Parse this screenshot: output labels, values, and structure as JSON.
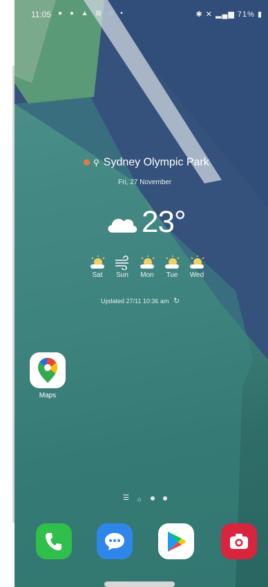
{
  "status_bar": {
    "time": "11:05",
    "left_icons": "● ● ▲ ⊠ ◌ •",
    "battery": "71%"
  },
  "weather": {
    "location": "Sydney Olympic Park",
    "date": "Fri, 27 November",
    "temperature": "23°",
    "forecast": [
      {
        "day": "Sat",
        "icon": "sun-cloud-icon"
      },
      {
        "day": "Sun",
        "icon": "wind-icon"
      },
      {
        "day": "Mon",
        "icon": "sun-cloud-icon"
      },
      {
        "day": "Tue",
        "icon": "sun-cloud-icon"
      },
      {
        "day": "Wed",
        "icon": "sun-cloud-icon"
      }
    ],
    "updated": "Updated 27/11 10:36 am"
  },
  "apps": {
    "maps": {
      "label": "Maps",
      "icon": "google-maps-icon"
    }
  },
  "page_indicator": {
    "pages": 3,
    "current": 1
  },
  "dock": [
    {
      "name": "phone",
      "icon": "phone-icon",
      "color": "#2fbf4a"
    },
    {
      "name": "messages",
      "icon": "chat-bubble-icon",
      "color": "#2f86ea"
    },
    {
      "name": "play-store",
      "icon": "play-store-icon",
      "color": "#ffffff"
    },
    {
      "name": "camera",
      "icon": "camera-icon",
      "color": "#d8243d"
    }
  ]
}
